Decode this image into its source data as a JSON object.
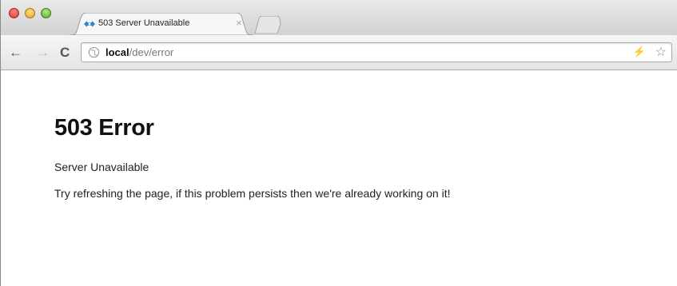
{
  "browser": {
    "tab": {
      "title": "503 Server Unavailable",
      "close_glyph": "×"
    },
    "toolbar": {
      "back_glyph": "←",
      "forward_glyph": "→",
      "reload_glyph": "C"
    },
    "address": {
      "host": "local",
      "path": "/dev/error",
      "bolt_glyph": "⚡",
      "star_glyph": "☆"
    },
    "icons": {
      "close": "close-window-icon",
      "minimize": "minimize-window-icon",
      "maximize": "maximize-window-icon",
      "favicon": "diamond-arrows-favicon-icon",
      "globe": "globe-icon"
    },
    "colors": {
      "favicon": "#2f7fd6",
      "traffic_close": "#d8342b",
      "traffic_min": "#e0a11a",
      "traffic_max": "#58a528"
    }
  },
  "page": {
    "heading": "503 Error",
    "subheading": "Server Unavailable",
    "message": "Try refreshing the page, if this problem persists then we're already working on it!"
  }
}
